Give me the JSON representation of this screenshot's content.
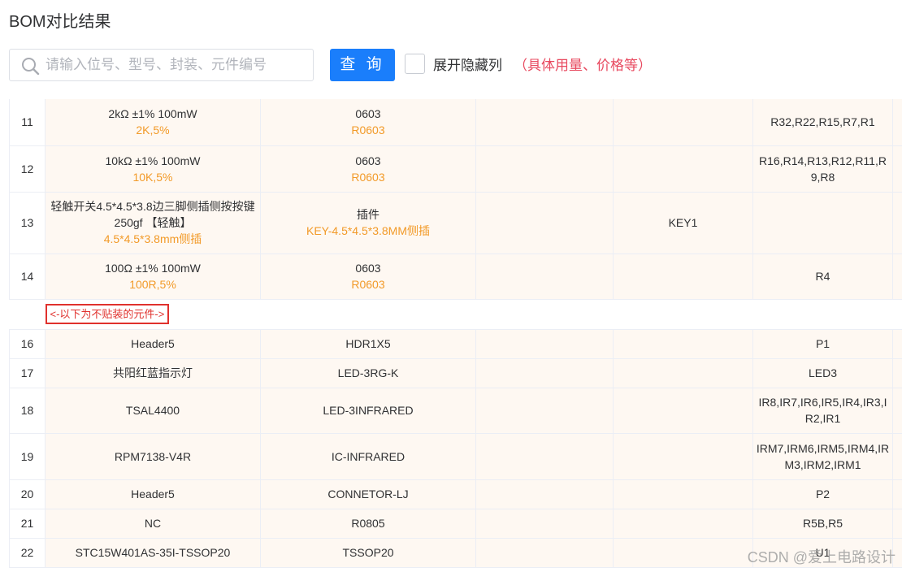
{
  "page": {
    "title": "BOM对比结果"
  },
  "search": {
    "placeholder": "请输入位号、型号、封装、元件编号",
    "value": ""
  },
  "query_button": {
    "label": "查 询"
  },
  "toggle": {
    "label": "展开隐藏列",
    "hint": "（具体用量、价格等）",
    "checked": false
  },
  "separator": {
    "text": "<-以下为不贴装的元件->"
  },
  "rows_top": [
    {
      "index": "11",
      "spec": "2kΩ ±1% 100mW",
      "spec_alt": "2K,5%",
      "package": "0603",
      "package_alt": "R0603",
      "col3": "",
      "col4": "",
      "refs": "R32,R22,R15,R7,R1"
    },
    {
      "index": "12",
      "spec": "10kΩ ±1% 100mW",
      "spec_alt": "10K,5%",
      "package": "0603",
      "package_alt": "R0603",
      "col3": "",
      "col4": "",
      "refs": "R16,R14,R13,R12,R11,R9,R8"
    },
    {
      "index": "13",
      "spec": "轻触开关4.5*4.5*3.8边三脚侧插侧按按键250gf 【轻触】",
      "spec_alt": "4.5*4.5*3.8mm侧插",
      "package": "插件",
      "package_alt": "KEY-4.5*4.5*3.8MM侧插",
      "col3": "",
      "col4": "KEY1",
      "refs": ""
    },
    {
      "index": "14",
      "spec": "100Ω ±1% 100mW",
      "spec_alt": "100R,5%",
      "package": "0603",
      "package_alt": "R0603",
      "col3": "",
      "col4": "",
      "refs": "R4"
    }
  ],
  "rows_bottom": [
    {
      "index": "16",
      "spec": "Header5",
      "package": "HDR1X5",
      "col3": "",
      "col4": "",
      "refs": "P1"
    },
    {
      "index": "17",
      "spec": "共阳红蓝指示灯",
      "package": "LED-3RG-K",
      "col3": "",
      "col4": "",
      "refs": "LED3"
    },
    {
      "index": "18",
      "spec": "TSAL4400",
      "package": "LED-3INFRARED",
      "col3": "",
      "col4": "",
      "refs": "IR8,IR7,IR6,IR5,IR4,IR3,IR2,IR1"
    },
    {
      "index": "19",
      "spec": "RPM7138-V4R",
      "package": "IC-INFRARED",
      "col3": "",
      "col4": "",
      "refs": "IRM7,IRM6,IRM5,IRM4,IRM3,IRM2,IRM1"
    },
    {
      "index": "20",
      "spec": "Header5",
      "package": "CONNETOR-LJ",
      "col3": "",
      "col4": "",
      "refs": "P2"
    },
    {
      "index": "21",
      "spec": "NC",
      "package": "R0805",
      "col3": "",
      "col4": "",
      "refs": "R5B,R5"
    },
    {
      "index": "22",
      "spec": "STC15W401AS-35I-TSSOP20",
      "package": "TSSOP20",
      "col3": "",
      "col4": "",
      "refs": "U1"
    }
  ],
  "watermark": "CSDN @爱上电路设计",
  "colors": {
    "accent": "#1a7efb",
    "alt_text": "#f29a28",
    "warning": "#e0312d",
    "row_bg": "#fef8f2"
  }
}
